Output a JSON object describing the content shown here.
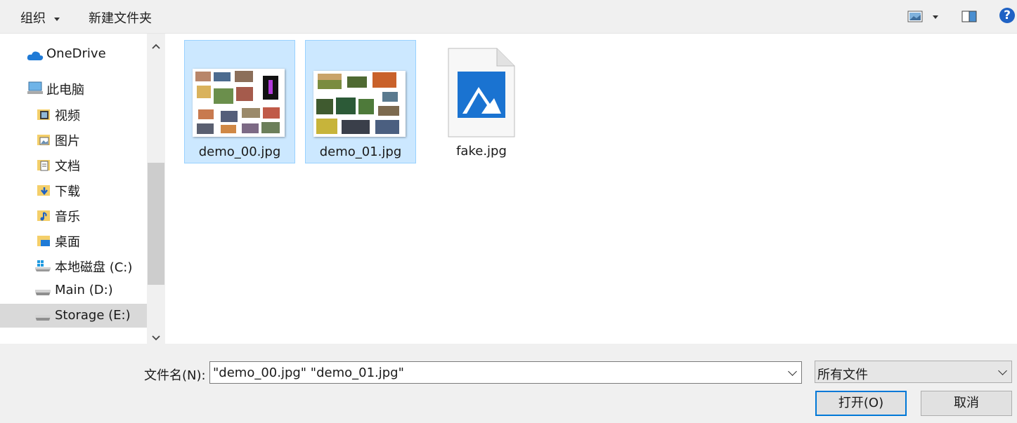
{
  "toolbar": {
    "organize_label": "组织",
    "new_folder_label": "新建文件夹",
    "help_label": "?"
  },
  "nav": {
    "items": [
      {
        "label": "OneDrive",
        "icon": "cloud-icon"
      },
      {
        "label": "此电脑",
        "icon": "computer-icon"
      },
      {
        "label": "视频",
        "icon": "video-folder-icon"
      },
      {
        "label": "图片",
        "icon": "pictures-folder-icon"
      },
      {
        "label": "文档",
        "icon": "documents-folder-icon"
      },
      {
        "label": "下载",
        "icon": "downloads-folder-icon"
      },
      {
        "label": "音乐",
        "icon": "music-folder-icon"
      },
      {
        "label": "桌面",
        "icon": "desktop-folder-icon"
      },
      {
        "label": "本地磁盘 (C:)",
        "icon": "windows-drive-icon"
      },
      {
        "label": "Main (D:)",
        "icon": "drive-icon"
      },
      {
        "label": "Storage (E:)",
        "icon": "drive-icon",
        "selected": true
      }
    ]
  },
  "files": [
    {
      "name": "demo_00.jpg",
      "selected": true,
      "icon": "photo-collage-thumbnail"
    },
    {
      "name": "demo_01.jpg",
      "selected": true,
      "icon": "photo-collage-thumbnail"
    },
    {
      "name": "fake.jpg",
      "selected": false,
      "icon": "image-file-icon"
    }
  ],
  "bottom": {
    "filename_label": "文件名(N):",
    "filename_value": "\"demo_00.jpg\" \"demo_01.jpg\"",
    "filetype_value": "所有文件",
    "open_label": "打开(O)",
    "cancel_label": "取消"
  },
  "colors": {
    "accent": "#0078d7",
    "selection_bg": "#cce8ff",
    "selection_border": "#99d1ff",
    "chrome_bg": "#f0f0f0"
  }
}
